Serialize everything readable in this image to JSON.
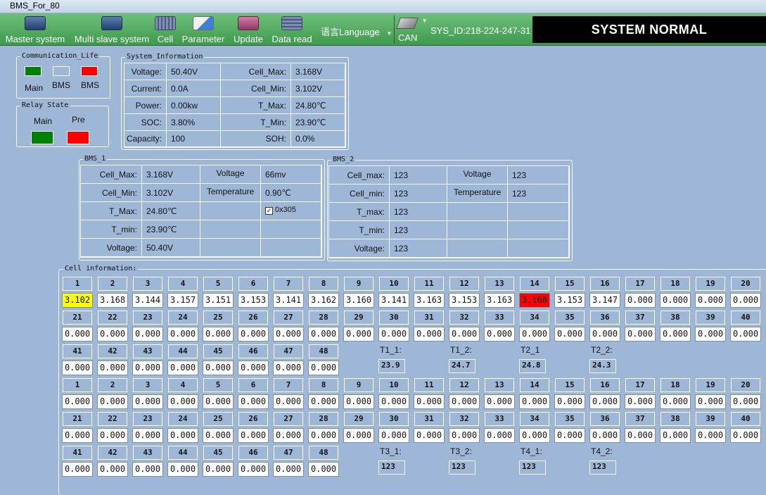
{
  "window": {
    "title": "BMS_For_80"
  },
  "toolbar": {
    "master_system": "Master system",
    "multi_slave_system": "Multi slave system",
    "cell": "Cell",
    "parameter": "Parameter",
    "update": "Update",
    "data_read": "Data read",
    "language": "语言Language",
    "can": "CAN",
    "sys_id": "SYS_ID:218-224-247-31",
    "status": "SYSTEM NORMAL",
    "status_color": "#000000"
  },
  "communication_life": {
    "title": "Communication_Life",
    "indicators": [
      {
        "label": "Main",
        "color": "#008000"
      },
      {
        "label": "BMS",
        "color": "#9fb7d6"
      },
      {
        "label": "BMS",
        "color": "#ff0000"
      }
    ]
  },
  "relay_state": {
    "title": "Relay State",
    "relays": [
      {
        "label": "Main",
        "color": "#008000"
      },
      {
        "label": "Pre",
        "color": "#ff0000"
      }
    ]
  },
  "system_information": {
    "title": "System_Information",
    "left": [
      {
        "label": "Voltage:",
        "value": "50.40V"
      },
      {
        "label": "Current:",
        "value": "0.0A"
      },
      {
        "label": "Power:",
        "value": "0.00kw"
      },
      {
        "label": "SOC:",
        "value": "3.80%"
      },
      {
        "label": "Capacity:",
        "value": "100"
      }
    ],
    "right": [
      {
        "label": "Cell_Max:",
        "value": "3.168V"
      },
      {
        "label": "Cell_Min:",
        "value": "3.102V"
      },
      {
        "label": "T_Max:",
        "value": "24.80℃"
      },
      {
        "label": "T_Min:",
        "value": "23.90℃"
      },
      {
        "label": "SOH:",
        "value": "0.0%"
      }
    ]
  },
  "bms1": {
    "title": "BMS_1",
    "rows": [
      {
        "label": "Cell_Max:",
        "value": "3.168V"
      },
      {
        "label": "Cell_Min:",
        "value": "3.102V"
      },
      {
        "label": "T_Max:",
        "value": "24.80℃"
      },
      {
        "label": "T_min:",
        "value": "23.90℃"
      },
      {
        "label": "Voltage:",
        "value": "50.40V"
      }
    ],
    "voltage_label": "Voltage",
    "voltage_value": "66mv",
    "temperature_label": "Temperature",
    "temperature_value": "0.90℃",
    "checkbox_label": "0x305",
    "checkbox_mark": "✓"
  },
  "bms2": {
    "title": "BMS_2",
    "rows": [
      {
        "label": "Cell_max:",
        "value": "123"
      },
      {
        "label": "Cell_min:",
        "value": "123"
      },
      {
        "label": "T_max:",
        "value": "123"
      },
      {
        "label": "T_min:",
        "value": "123"
      },
      {
        "label": "Voltage:",
        "value": "123"
      }
    ],
    "voltage_label": "Voltage",
    "voltage_value": "123",
    "temperature_label": "Temperature",
    "temperature_value": "123"
  },
  "cell_information": {
    "title": "Cell information:",
    "block1": {
      "row1_values": [
        "3.102",
        "3.168",
        "3.144",
        "3.157",
        "3.151",
        "3.153",
        "3.141",
        "3.162",
        "3.160",
        "3.141",
        "3.163",
        "3.153",
        "3.163",
        "3.168",
        "3.153",
        "3.147",
        "0.000",
        "0.000",
        "0.000",
        "0.000"
      ],
      "row2_values": [
        "0.000",
        "0.000",
        "0.000",
        "0.000",
        "0.000",
        "0.000",
        "0.000",
        "0.000",
        "0.000",
        "0.000",
        "0.000",
        "0.000",
        "0.000",
        "0.000",
        "0.000",
        "0.000",
        "0.000",
        "0.000",
        "0.000",
        "0.000"
      ],
      "row3_values": [
        "0.000",
        "0.000",
        "0.000",
        "0.000",
        "0.000",
        "0.000",
        "0.000",
        "0.000"
      ],
      "temps": [
        {
          "label": "T1_1:",
          "value": "23.9"
        },
        {
          "label": "T1_2:",
          "value": "24.7"
        },
        {
          "label": "T2_1",
          "value": "24.8"
        },
        {
          "label": "T2_2:",
          "value": "24.3"
        }
      ]
    },
    "block2": {
      "row1_values": [
        "0.000",
        "0.000",
        "0.000",
        "0.000",
        "0.000",
        "0.000",
        "0.000",
        "0.000",
        "0.000",
        "0.000",
        "0.000",
        "0.000",
        "0.000",
        "0.000",
        "0.000",
        "0.000",
        "0.000",
        "0.000",
        "0.000",
        "0.000"
      ],
      "row2_values": [
        "0.000",
        "0.000",
        "0.000",
        "0.000",
        "0.000",
        "0.000",
        "0.000",
        "0.000",
        "0.000",
        "0.000",
        "0.000",
        "0.000",
        "0.000",
        "0.000",
        "0.000",
        "0.000",
        "0.000",
        "0.000",
        "0.000",
        "0.000"
      ],
      "row3_values": [
        "0.000",
        "0.000",
        "0.000",
        "0.000",
        "0.000",
        "0.000",
        "0.000",
        "0.000"
      ],
      "temps": [
        {
          "label": "T3_1:",
          "value": "123"
        },
        {
          "label": "T3_2:",
          "value": "123"
        },
        {
          "label": "T4_1:",
          "value": "123"
        },
        {
          "label": "T4_2:",
          "value": "123"
        }
      ]
    },
    "min_cell_color": "#ffff00",
    "max_cell_color": "#ff0000"
  },
  "labels": {
    "n1": "1",
    "n2": "2",
    "n3": "3",
    "n4": "4",
    "n5": "5",
    "n6": "6",
    "n7": "7",
    "n8": "8",
    "n9": "9",
    "n10": "10",
    "n11": "11",
    "n12": "12",
    "n13": "13",
    "n14": "14",
    "n15": "15",
    "n16": "16",
    "n17": "17",
    "n18": "18",
    "n19": "19",
    "n20": "20",
    "n21": "21",
    "n22": "22",
    "n23": "23",
    "n24": "24",
    "n25": "25",
    "n26": "26",
    "n27": "27",
    "n28": "28",
    "n29": "29",
    "n30": "30",
    "n31": "31",
    "n32": "32",
    "n33": "33",
    "n34": "34",
    "n35": "35",
    "n36": "36",
    "n37": "37",
    "n38": "38",
    "n39": "39",
    "n40": "40",
    "n41": "41",
    "n42": "42",
    "n43": "43",
    "n44": "44",
    "n45": "45",
    "n46": "46",
    "n47": "47",
    "n48": "48"
  }
}
